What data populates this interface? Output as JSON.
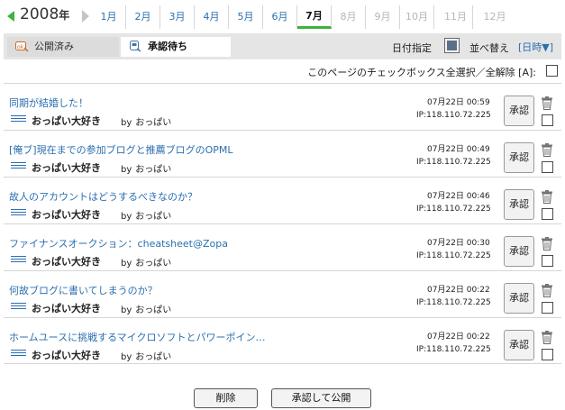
{
  "nav": {
    "year": "2008",
    "year_suffix": "年",
    "months": [
      {
        "label": "1月",
        "state": "enabled"
      },
      {
        "label": "2月",
        "state": "enabled"
      },
      {
        "label": "3月",
        "state": "enabled"
      },
      {
        "label": "4月",
        "state": "enabled"
      },
      {
        "label": "5月",
        "state": "enabled"
      },
      {
        "label": "6月",
        "state": "enabled"
      },
      {
        "label": "7月",
        "state": "active"
      },
      {
        "label": "8月",
        "state": "disabled"
      },
      {
        "label": "9月",
        "state": "disabled"
      },
      {
        "label": "10月",
        "state": "disabled"
      },
      {
        "label": "11月",
        "state": "disabled"
      },
      {
        "label": "12月",
        "state": "disabled"
      }
    ]
  },
  "toolbar": {
    "tab_published": "公開済み",
    "tab_pending": "承認待ち",
    "date_label": "日付指定",
    "sort_label": "並べ替え",
    "sort_value": "[日時▼]"
  },
  "select_all": {
    "label": "このページのチェックボックス全選択／全解除 [A]:"
  },
  "entries": [
    {
      "title": "同期が結婚した！",
      "blog": "おっぱい大好き",
      "by": "by",
      "author": "おっぱい",
      "date": "07月22日 00:59",
      "ip": "IP:118.110.72.225",
      "approve": "承認"
    },
    {
      "title": "[俺ブ]現在までの参加ブログと推薦ブログのOPML",
      "blog": "おっぱい大好き",
      "by": "by",
      "author": "おっぱい",
      "date": "07月22日 00:49",
      "ip": "IP:118.110.72.225",
      "approve": "承認"
    },
    {
      "title": "故人のアカウントはどうするべきなのか？",
      "blog": "おっぱい大好き",
      "by": "by",
      "author": "おっぱい",
      "date": "07月22日 00:46",
      "ip": "IP:118.110.72.225",
      "approve": "承認"
    },
    {
      "title": "ファイナンスオークション：cheatsheet@Zopa",
      "blog": "おっぱい大好き",
      "by": "by",
      "author": "おっぱい",
      "date": "07月22日 00:30",
      "ip": "IP:118.110.72.225",
      "approve": "承認"
    },
    {
      "title": "何故ブログに書いてしまうのか？",
      "blog": "おっぱい大好き",
      "by": "by",
      "author": "おっぱい",
      "date": "07月22日 00:22",
      "ip": "IP:118.110.72.225",
      "approve": "承認"
    },
    {
      "title": "ホームユースに挑戦するマイクロソフトとパワーポイン…",
      "blog": "おっぱい大好き",
      "by": "by",
      "author": "おっぱい",
      "date": "07月22日 00:22",
      "ip": "IP:118.110.72.225",
      "approve": "承認"
    }
  ],
  "actions": {
    "delete": "削除",
    "approve_publish": "承認して公開"
  },
  "colors": {
    "accent": "#3db33d",
    "link": "#2a6fb0"
  }
}
